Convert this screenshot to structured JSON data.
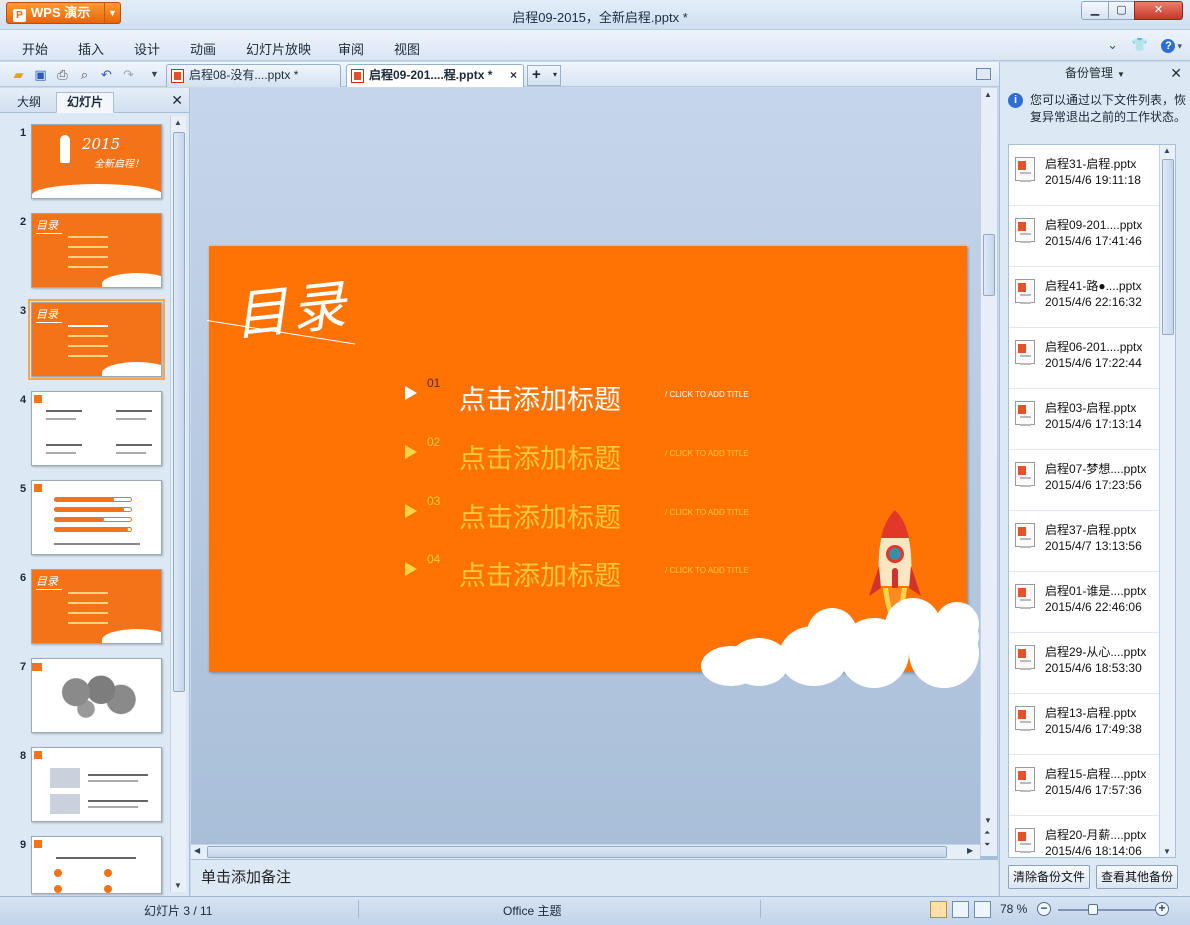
{
  "app": {
    "menu_label": "WPS 演示",
    "logo_glyph": "P",
    "window_title": "启程09-2015，全新启程.pptx *"
  },
  "menu": {
    "items": [
      "开始",
      "插入",
      "设计",
      "动画",
      "幻灯片放映",
      "审阅",
      "视图"
    ]
  },
  "doc_tabs": [
    {
      "label": "启程08-没有....pptx *",
      "active": false
    },
    {
      "label": "启程09-201....程.pptx *",
      "active": true
    }
  ],
  "left_panel": {
    "tabs": [
      "大纲",
      "幻灯片"
    ],
    "active_tab": "幻灯片",
    "slides": [
      {
        "number": "1",
        "style": "title",
        "year": "2015",
        "subtitle": "全新启程！"
      },
      {
        "number": "2",
        "style": "toc",
        "heading": "目录"
      },
      {
        "number": "3",
        "style": "toc",
        "heading": "目录",
        "selected": true
      },
      {
        "number": "4",
        "style": "text"
      },
      {
        "number": "5",
        "style": "bars"
      },
      {
        "number": "6",
        "style": "toc",
        "heading": "目录"
      },
      {
        "number": "7",
        "style": "map"
      },
      {
        "number": "8",
        "style": "photos"
      },
      {
        "number": "9",
        "style": "icons"
      }
    ]
  },
  "slide": {
    "title": "目录",
    "items": [
      {
        "number": "01",
        "title": "点击添加标题",
        "subtitle": "/ CLICK TO ADD TITLE"
      },
      {
        "number": "02",
        "title": "点击添加标题",
        "subtitle": "/ CLICK TO ADD TITLE"
      },
      {
        "number": "03",
        "title": "点击添加标题",
        "subtitle": "/ CLICK TO ADD TITLE"
      },
      {
        "number": "04",
        "title": "点击添加标题",
        "subtitle": "/ CLICK TO ADD TITLE"
      }
    ]
  },
  "notes": {
    "placeholder": "单击添加备注"
  },
  "backup_panel": {
    "title": "备份管理",
    "info": "您可以通过以下文件列表，恢复异常退出之前的工作状态。",
    "files": [
      {
        "name": "启程31-启程.pptx",
        "time": "2015/4/6 19:11:18"
      },
      {
        "name": "启程09-201....pptx",
        "time": "2015/4/6 17:41:46"
      },
      {
        "name": "启程41-路●....pptx",
        "time": "2015/4/6 22:16:32"
      },
      {
        "name": "启程06-201....pptx",
        "time": "2015/4/6 17:22:44"
      },
      {
        "name": "启程03-启程.pptx",
        "time": "2015/4/6 17:13:14"
      },
      {
        "name": "启程07-梦想....pptx",
        "time": "2015/4/6 17:23:56"
      },
      {
        "name": "启程37-启程.pptx",
        "time": "2015/4/7 13:13:56"
      },
      {
        "name": "启程01-谁是....pptx",
        "time": "2015/4/6 22:46:06"
      },
      {
        "name": "启程29-从心....pptx",
        "time": "2015/4/6 18:53:30"
      },
      {
        "name": "启程13-启程.pptx",
        "time": "2015/4/6 17:49:38"
      },
      {
        "name": "启程15-启程....pptx",
        "time": "2015/4/6 17:57:36"
      },
      {
        "name": "启程20-月薪....pptx",
        "time": "2015/4/6 18:14:06"
      }
    ],
    "clear_button": "清除备份文件",
    "view_button": "查看其他备份"
  },
  "status": {
    "slide_info": "幻灯片 3 / 11",
    "theme": "Office 主题",
    "zoom": "78 %",
    "zoom_fraction": 0.34
  },
  "colors": {
    "slide_bg": "#fe7303",
    "accent": "#ffc63a"
  }
}
